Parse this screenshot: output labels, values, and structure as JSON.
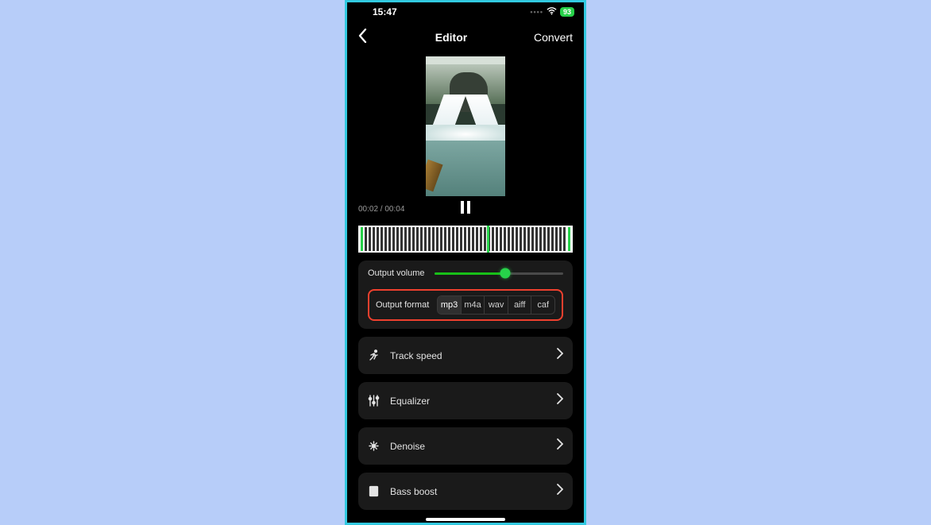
{
  "status": {
    "time": "15:47",
    "battery": "93"
  },
  "nav": {
    "title": "Editor",
    "convert": "Convert"
  },
  "player": {
    "timecode": "00:02 / 00:04"
  },
  "volume": {
    "label": "Output volume",
    "percent": 55
  },
  "format": {
    "label": "Output format",
    "options": [
      "mp3",
      "m4a",
      "wav",
      "aiff",
      "caf"
    ],
    "selected": "mp3"
  },
  "rows": {
    "speed": "Track speed",
    "eq": "Equalizer",
    "denoise": "Denoise",
    "bass": "Bass boost"
  }
}
